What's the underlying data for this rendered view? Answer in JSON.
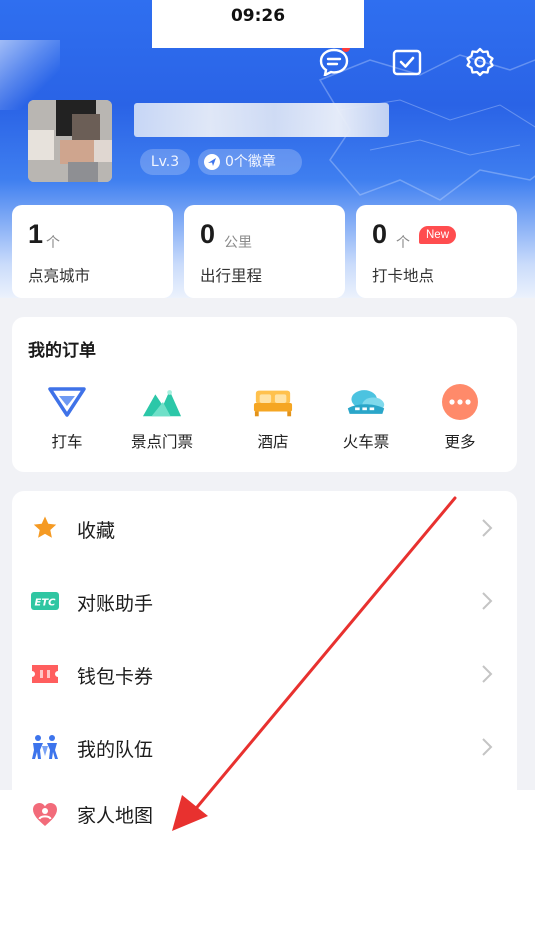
{
  "status_bar": {
    "time": "09:26"
  },
  "header": {
    "icons": [
      "message-icon",
      "checkin-icon",
      "settings-icon"
    ],
    "level": "Lv.3",
    "medals": "0个徽章"
  },
  "stats": [
    {
      "value": "1",
      "unit": "个",
      "label": "点亮城市"
    },
    {
      "value": "0",
      "unit": "公里",
      "label": "出行里程"
    },
    {
      "value": "0",
      "unit": "个",
      "label": "打卡地点",
      "tag": "New"
    }
  ],
  "orders": {
    "title": "我的订单",
    "items": [
      {
        "label": "打车",
        "icon": "taxi-icon"
      },
      {
        "label": "景点门票",
        "icon": "scenic-ticket-icon"
      },
      {
        "label": "酒店",
        "icon": "hotel-icon"
      },
      {
        "label": "火车票",
        "icon": "train-ticket-icon"
      },
      {
        "label": "更多",
        "icon": "more-icon"
      }
    ]
  },
  "menu": [
    {
      "label": "收藏",
      "icon": "star-icon"
    },
    {
      "label": "对账助手",
      "icon": "etc-icon"
    },
    {
      "label": "钱包卡券",
      "icon": "ticket-icon"
    },
    {
      "label": "我的队伍",
      "icon": "team-icon"
    },
    {
      "label": "家人地图",
      "icon": "family-map-icon"
    }
  ],
  "colors": {
    "header_blue": "#2f6ff0",
    "arrow_red": "#e8312f",
    "new_tag": "#ff4d4f",
    "page_bg": "#f1f2f6"
  }
}
